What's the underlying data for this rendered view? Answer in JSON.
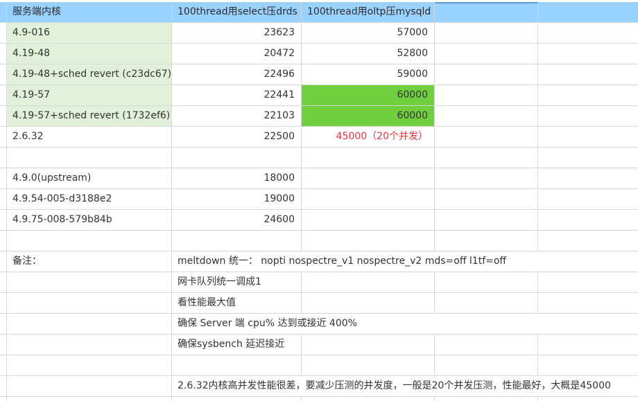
{
  "header": {
    "col_a": "服务端内核",
    "col_b": "100thread用select压drds",
    "col_c": "100thread用oltp压mysqld"
  },
  "rows": [
    {
      "kernel": "4.9-016",
      "drds": "23623",
      "mysqld": "57000"
    },
    {
      "kernel": "4.19-48",
      "drds": "20472",
      "mysqld": "52800"
    },
    {
      "kernel": "4.19-48+sched revert (c23dc67)",
      "drds": "22496",
      "mysqld": "59000"
    },
    {
      "kernel": "4.19-57",
      "drds": "22441",
      "mysqld": "60000"
    },
    {
      "kernel": "4.19-57+sched revert (1732ef6)",
      "drds": "22103",
      "mysqld": "60000"
    },
    {
      "kernel": "2.6.32",
      "drds": "22500",
      "mysqld": "45000（20个并发）"
    },
    {
      "kernel": "",
      "drds": "",
      "mysqld": ""
    },
    {
      "kernel": "4.9.0(upstream)",
      "drds": "18000",
      "mysqld": ""
    },
    {
      "kernel": "4.9.54-005-d3188e2",
      "drds": "19000",
      "mysqld": ""
    },
    {
      "kernel": "4.9.75-008-579b84b",
      "drds": "24600",
      "mysqld": ""
    }
  ],
  "notes": {
    "label": "备注：",
    "lines": [
      "meltdown 统一： nopti nospectre_v1 nospectre_v2 mds=off l1tf=off",
      "网卡队列统一调成1",
      "看性能最大值",
      "确保 Server 端 cpu% 达到或接近 400%",
      "确保sysbench 延迟接近"
    ],
    "final": "2.6.32内核高并发性能很差，要减少压测的并发度，一般是20个并发压测，性能最好，大概是45000"
  },
  "colors": {
    "header_bg": "#99d1ff",
    "light_green": "#e2f0d9",
    "highlight_green": "#70cf3f",
    "red_text": "#e8303a"
  }
}
